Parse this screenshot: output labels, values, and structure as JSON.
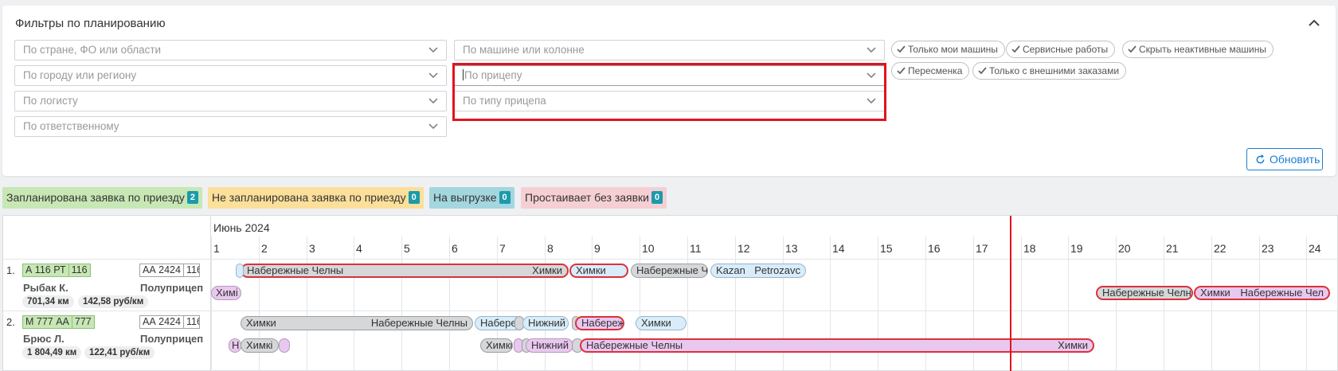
{
  "filters": {
    "title": "Фильтры по планированию",
    "selects_left": [
      {
        "placeholder": "По стране, ФО или области"
      },
      {
        "placeholder": "По городу или региону"
      },
      {
        "placeholder": "По логисту"
      },
      {
        "placeholder": "По ответственному"
      }
    ],
    "selects_mid": [
      {
        "placeholder": "По машине или колонне"
      },
      {
        "placeholder": "По прицепу"
      },
      {
        "placeholder": "По типу прицепа"
      }
    ],
    "chips": [
      {
        "label": "Только мои машины"
      },
      {
        "label": "Сервисные работы"
      },
      {
        "label": "Скрыть неактивные машины"
      },
      {
        "label": "Пересменка"
      },
      {
        "label": "Только с внешними заказами"
      }
    ],
    "refresh_label": "Обновить"
  },
  "legend": [
    {
      "label": "Запланирована заявка по приезду",
      "count": "2",
      "color": "#c7e7b5"
    },
    {
      "label": "Не запланирована заявка по приезду",
      "count": "0",
      "color": "#fbdf9a"
    },
    {
      "label": "На выгрузке",
      "count": "0",
      "color": "#a3d6df"
    },
    {
      "label": "Простаивает без заявки",
      "count": "0",
      "color": "#f5cfd3"
    }
  ],
  "gantt": {
    "month": "Июнь 2024",
    "days": [
      "1",
      "2",
      "3",
      "4",
      "5",
      "6",
      "7",
      "8",
      "9",
      "10",
      "11",
      "12",
      "13",
      "14",
      "15",
      "16",
      "17",
      "18",
      "19",
      "20",
      "21",
      "22",
      "23",
      "24"
    ],
    "rows": [
      {
        "num": "1.",
        "plate": [
          "А 116 РТ",
          "116"
        ],
        "trailer": [
          "АА 2424",
          "116"
        ],
        "trailer_type": "Полуприцеп",
        "driver": "Рыбак К.",
        "distance": "701,34 км",
        "rate": "142,58 руб/км",
        "bars_top": [
          {
            "l": "Набережные Челны",
            "r": "Химки"
          },
          {
            "l": "Химки",
            "r": ""
          },
          {
            "l": "Набережные Че",
            "r": ""
          },
          {
            "l": "Kazan",
            "r": "Petrozavc"
          }
        ],
        "bars_bottom": [
          {
            "l": "Химі",
            "r": ""
          },
          {
            "l": "Набережные Челнь",
            "r": ""
          },
          {
            "l": "Химки",
            "r": "Набережные Чел"
          }
        ]
      },
      {
        "num": "2.",
        "plate": [
          "М 777 АА",
          "777"
        ],
        "trailer": [
          "АА 2424",
          "116"
        ],
        "trailer_type": "Полуприцеп",
        "driver": "Брюс Л.",
        "distance": "1 804,49 км",
        "rate": "122,41 руб/км",
        "bars_top": [
          {
            "l": "Химки",
            "r": "Набережные Челны"
          },
          {
            "l": "Набереж",
            "r": ""
          },
          {
            "l": "Нижний",
            "r": ""
          },
          {
            "l": "Набереж",
            "r": ""
          },
          {
            "l": "Химки",
            "r": ""
          }
        ],
        "bars_bottom": [
          {
            "l": "Н",
            "r": ""
          },
          {
            "l": "Химкі",
            "r": ""
          },
          {
            "l": "Химкі",
            "r": ""
          },
          {
            "l": "Нижний",
            "r": ""
          },
          {
            "l": "Набережные Челны",
            "r": "Химки"
          }
        ]
      }
    ]
  }
}
